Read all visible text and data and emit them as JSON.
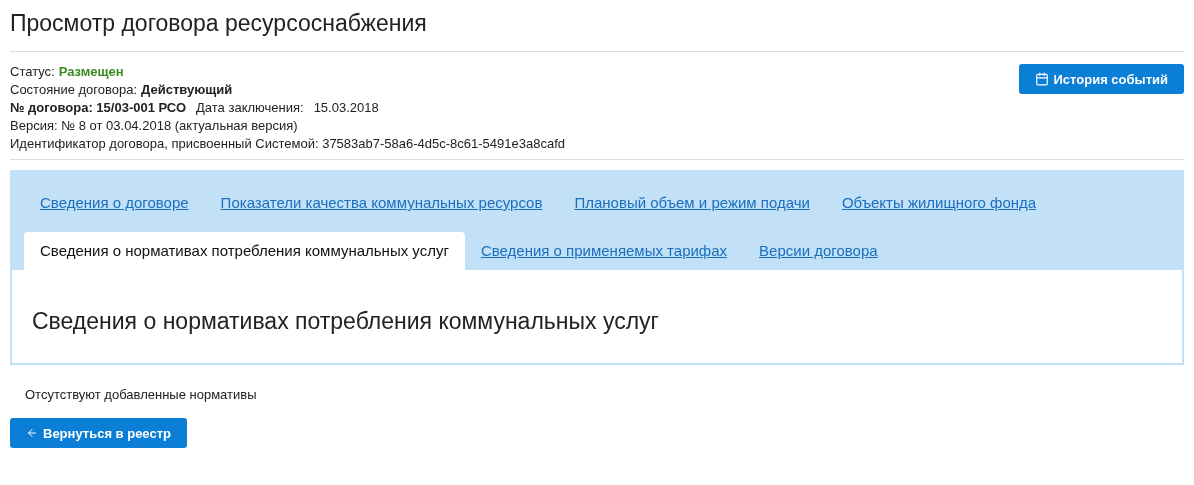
{
  "page_title": "Просмотр договора ресурсоснабжения",
  "info": {
    "status_label": "Статус:",
    "status_value": "Размещен",
    "state_label": "Состояние договора:",
    "state_value": "Действующий",
    "number": "№ договора: 15/03-001 РСО",
    "date_label": "Дата заключения:",
    "date_value": "15.03.2018",
    "version": "Версия: № 8 от 03.04.2018 (актуальная версия)",
    "identifier": "Идентификатор договора, присвоенный Системой: 37583ab7-58a6-4d5c-8c61-5491e3a8cafd"
  },
  "history_button": "История событий",
  "tab_rows": [
    [
      {
        "label": "Сведения о договоре",
        "selected": false
      },
      {
        "label": "Показатели качества коммунальных ресурсов",
        "selected": false
      },
      {
        "label": "Плановый объем и режим подачи",
        "selected": false
      },
      {
        "label": "Объекты жилищного фонда",
        "selected": false
      }
    ],
    [
      {
        "label": "Сведения о нормативах потребления коммунальных услуг",
        "selected": true
      },
      {
        "label": "Сведения о применяемых тарифах",
        "selected": false
      },
      {
        "label": "Версии договора",
        "selected": false
      }
    ]
  ],
  "panel_title": "Сведения о нормативах потребления коммунальных услуг",
  "empty_message": "Отсутствуют добавленные нормативы",
  "back_button": "Вернуться в реестр"
}
